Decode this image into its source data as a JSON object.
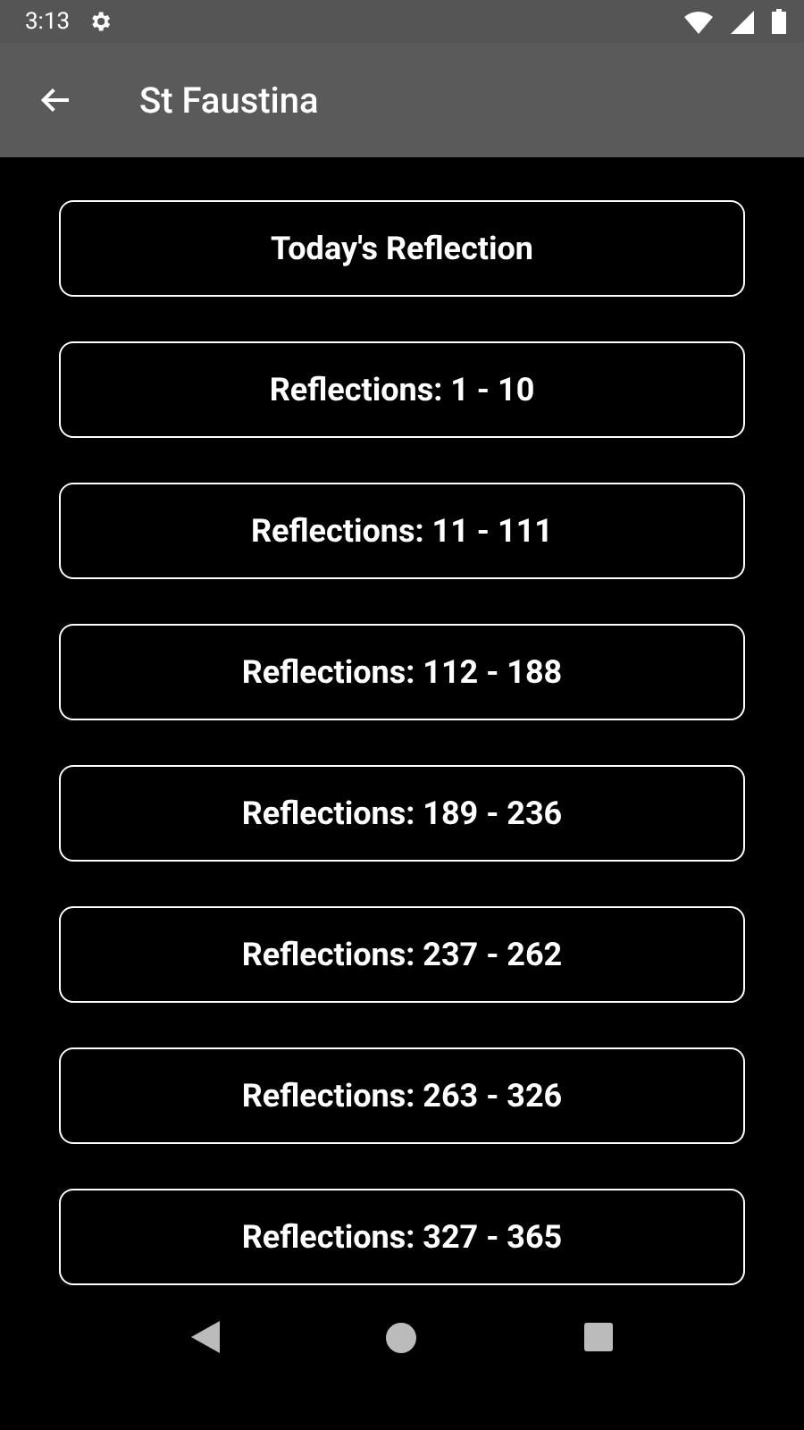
{
  "status_bar": {
    "time": "3:13"
  },
  "app_bar": {
    "title": "St Faustina"
  },
  "buttons": [
    {
      "label": "Today's Reflection"
    },
    {
      "label": "Reflections: 1 - 10"
    },
    {
      "label": "Reflections: 11 - 111"
    },
    {
      "label": "Reflections: 112 - 188"
    },
    {
      "label": "Reflections: 189 - 236"
    },
    {
      "label": "Reflections: 237 - 262"
    },
    {
      "label": "Reflections: 263 - 326"
    },
    {
      "label": "Reflections: 327 - 365"
    }
  ]
}
